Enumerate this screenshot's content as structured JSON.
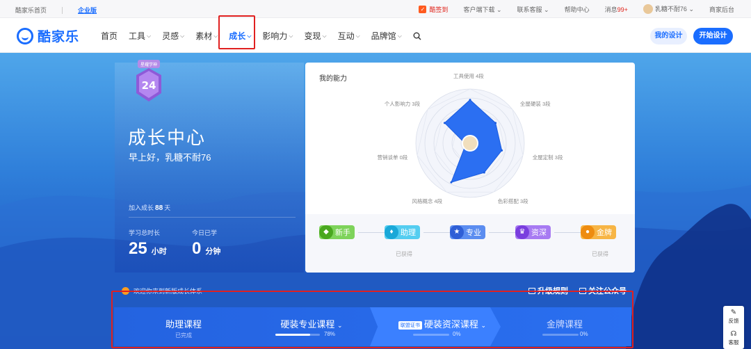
{
  "topbar": {
    "home": "酷家乐首页",
    "enterprise": "企业版",
    "checkin": "酷签到",
    "client_download": "客户端下载",
    "support": "联系客服",
    "help": "帮助中心",
    "messages": "消息",
    "messages_count": "99+",
    "username": "乳糖不耐76",
    "merchant": "商家后台"
  },
  "nav": {
    "logo": "酷家乐",
    "items": [
      {
        "label": "首页",
        "dropdown": false
      },
      {
        "label": "工具",
        "dropdown": true
      },
      {
        "label": "灵感",
        "dropdown": true
      },
      {
        "label": "素材",
        "dropdown": true
      },
      {
        "label": "成长",
        "dropdown": true,
        "active": true
      },
      {
        "label": "影响力",
        "dropdown": true
      },
      {
        "label": "变现",
        "dropdown": true
      },
      {
        "label": "互动",
        "dropdown": true
      },
      {
        "label": "品牌馆",
        "dropdown": true
      }
    ],
    "my_design": "我的设计",
    "start_design": "开始设计",
    "accent": "#1a6dff"
  },
  "profile": {
    "badge_top": "星耀学神",
    "badge_number": "24",
    "title": "成长中心",
    "greeting": "早上好，乳糖不耐76",
    "joined_label": "加入成长",
    "joined_days": "88",
    "joined_unit": "天",
    "study_label": "学习总时长",
    "study_value": "25",
    "study_unit": "小时",
    "today_label": "今日已学",
    "today_value": "0",
    "today_unit": "分钟"
  },
  "ability": {
    "title": "我的能力",
    "axes": [
      {
        "label": "工具使用 4段",
        "value": 4
      },
      {
        "label": "全屋硬装 3段",
        "value": 3
      },
      {
        "label": "全屋定制 3段",
        "value": 3
      },
      {
        "label": "色彩搭配 3段",
        "value": 3
      },
      {
        "label": "风格概念 4段",
        "value": 4
      },
      {
        "label": "营销谈单 0段",
        "value": 0
      },
      {
        "label": "个人影响力 3段",
        "value": 3
      }
    ],
    "levels": [
      {
        "label": "新手",
        "color": "#5bbf2e",
        "status": ""
      },
      {
        "label": "助理",
        "color": "#23b8e6",
        "status": "已获得"
      },
      {
        "label": "专业",
        "color": "#3b6fe6",
        "status": ""
      },
      {
        "label": "资深",
        "color": "#8a4de6",
        "status": ""
      },
      {
        "label": "金牌",
        "color": "#f59b16",
        "status": "已获得"
      }
    ]
  },
  "notice": {
    "text": "欢迎你来到新版成长体系",
    "rules": "升级规则",
    "follow": "关注公众号"
  },
  "courses": [
    {
      "name": "助理课程",
      "sub": "已完成",
      "percent": ""
    },
    {
      "name": "硬装专业课程",
      "sub": "",
      "percent": "78%",
      "progress": 0.78
    },
    {
      "name": "硬装资深课程",
      "tag": "联盟证书",
      "sub": "",
      "percent": "0%",
      "progress": 0
    },
    {
      "name": "金牌课程",
      "sub": "",
      "percent": "0%",
      "progress": 0
    }
  ],
  "side": {
    "feedback": "反馈",
    "service": "客服"
  }
}
